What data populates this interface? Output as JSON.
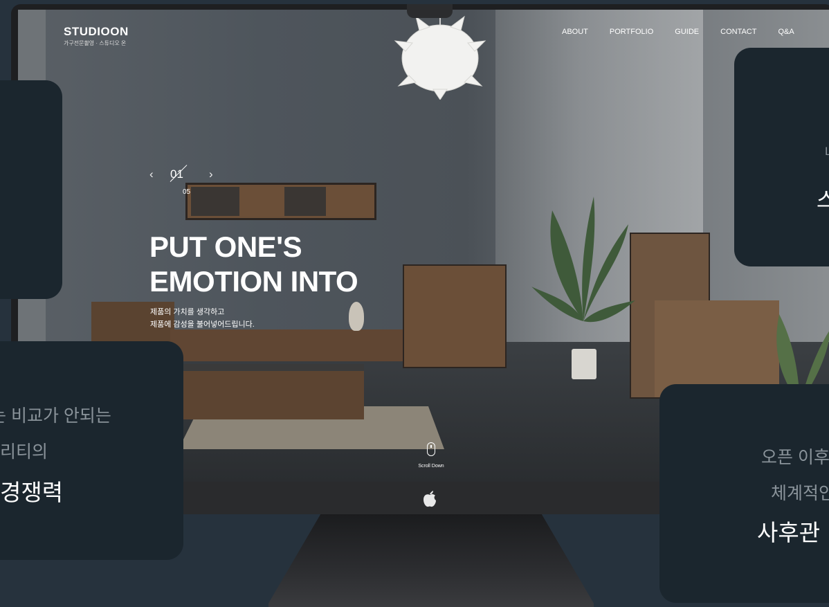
{
  "site": {
    "logo_main": "STUDIO",
    "logo_on": "ON",
    "logo_sub": "가구전문촬영 · 스튜디오 온",
    "nav": [
      "ABOUT",
      "PORTFOLIO",
      "GUIDE",
      "CONTACT",
      "Q&A"
    ]
  },
  "slider": {
    "current": "01",
    "total": "05",
    "prev_label": "‹",
    "next_label": "›"
  },
  "hero": {
    "title_line1": "PUT ONE'S",
    "title_line2": "EMOTION INTO",
    "sub_line1": "제품의 가치를 생각하고",
    "sub_line2": "제품에 감성을 불어넣어드립니다."
  },
  "scroll_label": "Scroll Down",
  "cards": {
    "bottom_left": {
      "line1": "는 비교가 안되는",
      "line2": "리티의",
      "line3": "경쟁력"
    },
    "top_right": {
      "line1": "L",
      "line2": "스"
    },
    "bottom_right": {
      "line1": "오픈 이후",
      "line2": "체계적인",
      "line3": "사후관"
    }
  }
}
